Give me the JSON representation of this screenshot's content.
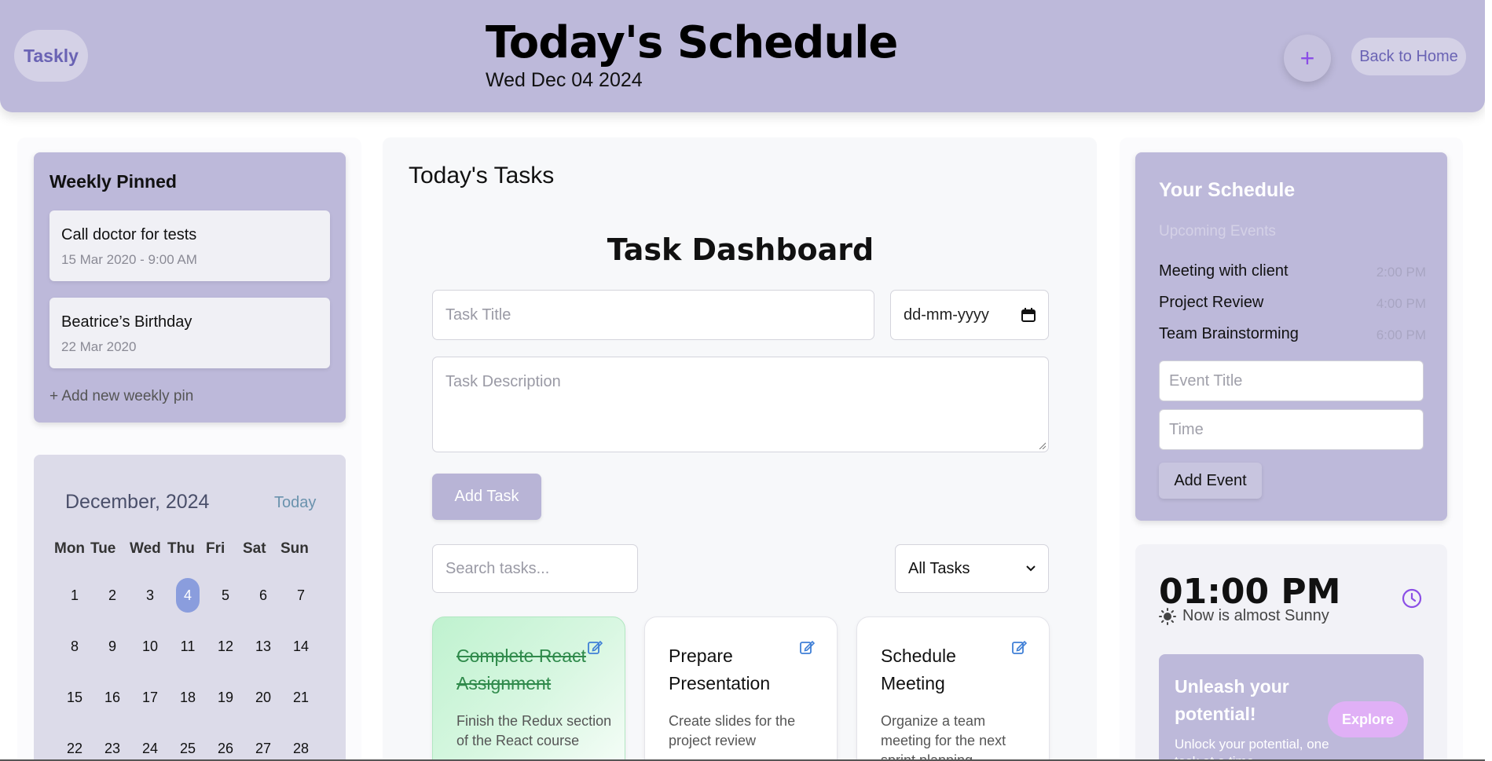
{
  "header": {
    "brand": "Taskly",
    "title": "Today's Schedule",
    "date": "Wed Dec 04 2024",
    "add_label": "+",
    "home_label": "Back to Home"
  },
  "pinned": {
    "title": "Weekly Pinned",
    "items": [
      {
        "text": "Call doctor for tests",
        "date": "15 Mar 2020 - 9:00 AM"
      },
      {
        "text": "Beatrice’s Birthday",
        "date": "22 Mar 2020"
      }
    ],
    "add_label": "+ Add new weekly pin"
  },
  "calendar": {
    "month": "December, 2024",
    "today_label": "Today",
    "weekdays": [
      "Mon",
      "Tue",
      "Wed",
      "Thu",
      "Fri",
      "Sat",
      "Sun"
    ],
    "weeks": [
      [
        "1",
        "2",
        "3",
        "4",
        "5",
        "6",
        "7"
      ],
      [
        "8",
        "9",
        "10",
        "11",
        "12",
        "13",
        "14"
      ],
      [
        "15",
        "16",
        "17",
        "18",
        "19",
        "20",
        "21"
      ],
      [
        "22",
        "23",
        "24",
        "25",
        "26",
        "27",
        "28"
      ]
    ],
    "selected_day": "4"
  },
  "main": {
    "section_title": "Today's Tasks",
    "dashboard_title": "Task Dashboard",
    "task_title_placeholder": "Task Title",
    "date_placeholder": "dd-mm-yyyy",
    "description_placeholder": "Task Description",
    "add_task_label": "Add Task",
    "search_placeholder": "Search tasks...",
    "filter_selected": "All Tasks",
    "tasks": [
      {
        "title": "Complete React Assignment",
        "description": "Finish the Redux section of the React course",
        "completed": true
      },
      {
        "title": "Prepare Presentation",
        "description": "Create slides for the project review",
        "completed": false
      },
      {
        "title": "Schedule Meeting",
        "description": "Organize a team meeting for the next sprint planning",
        "completed": false
      }
    ]
  },
  "schedule": {
    "title": "Your Schedule",
    "subtitle": "Upcoming Events",
    "events": [
      {
        "name": "Meeting with client",
        "time": "2:00 PM"
      },
      {
        "name": "Project Review",
        "time": "4:00 PM"
      },
      {
        "name": "Team Brainstorming",
        "time": "6:00 PM"
      }
    ],
    "event_title_placeholder": "Event Title",
    "time_placeholder": "Time",
    "add_event_label": "Add Event"
  },
  "clock": {
    "time": "01:00 PM",
    "weather": "Now is almost Sunny"
  },
  "promo": {
    "title": "Unleash your potential!",
    "subtitle": "Unlock your potential, one task at a time.",
    "explore_label": "Explore"
  },
  "colors": {
    "header_bg": "#bdb9da",
    "accent_purple": "#8b4ee6",
    "done_green": "#2f8a4b",
    "selected_day": "#8a9ddd"
  }
}
